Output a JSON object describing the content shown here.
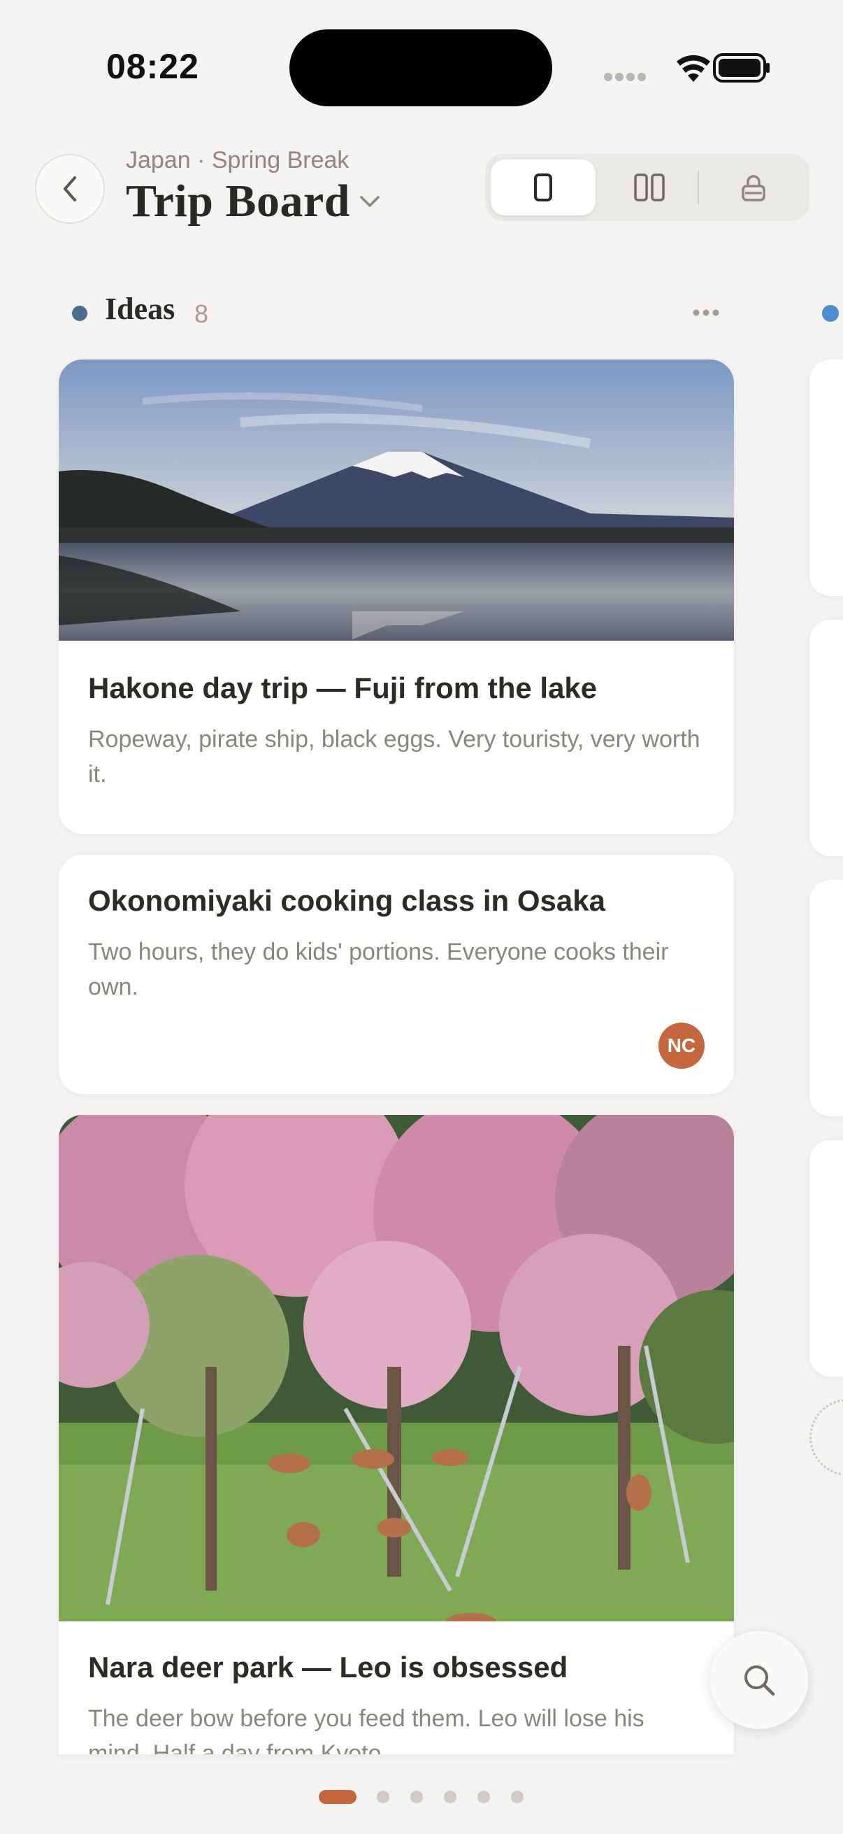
{
  "status_bar": {
    "time": "08:22"
  },
  "header": {
    "subtitle": "Japan · Spring Break",
    "title": "Trip Board"
  },
  "view_switch": {
    "options": [
      "single-column",
      "two-column",
      "locked"
    ],
    "selected": "single-column"
  },
  "column": {
    "title": "Ideas",
    "count": "8",
    "color": "#4e6d8c"
  },
  "next_column": {
    "color": "#4f8fd0"
  },
  "cards": [
    {
      "title": "Hakone day trip — Fuji from the lake",
      "description": "Ropeway, pirate ship, black eggs. Very touristy, very worth it.",
      "image": "mount-fuji-lake-photo"
    },
    {
      "title": "Okonomiyaki cooking class in Osaka",
      "description": "Two hours, they do kids' portions. Everyone cooks their own.",
      "avatar": "NC"
    },
    {
      "title": "Nara deer park — Leo is obsessed",
      "description": "The deer bow before you feed them. Leo will lose his mind. Half a day from Kyoto.",
      "image": "nara-deer-park-photo"
    }
  ],
  "pagination": {
    "total": 6,
    "active": 1
  },
  "colors": {
    "accent": "#c5673e",
    "background": "#f4f3f1"
  }
}
